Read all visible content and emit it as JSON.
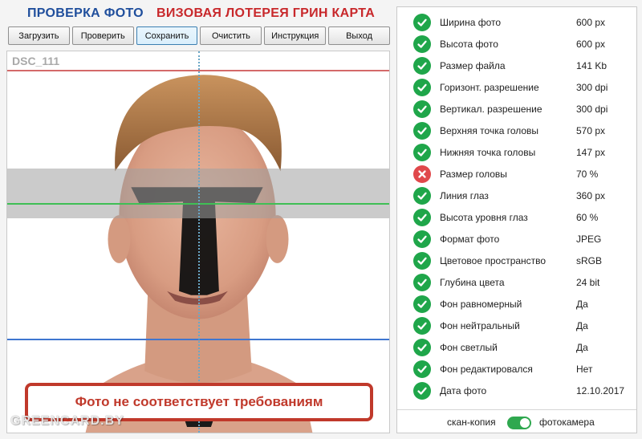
{
  "header": {
    "title_left": "ПРОВЕРКА ФОТО",
    "title_right": "ВИЗОВАЯ ЛОТЕРЕЯ ГРИН КАРТА"
  },
  "toolbar": [
    {
      "label": "Загрузить"
    },
    {
      "label": "Проверить"
    },
    {
      "label": "Сохранить"
    },
    {
      "label": "Очистить"
    },
    {
      "label": "Инструкция"
    },
    {
      "label": "Выход"
    }
  ],
  "photo": {
    "file_name": "DSC_111",
    "status_message": "Фото не соответствует требованиям",
    "watermark": "GREENCARD.BY"
  },
  "checks": [
    {
      "label": "Ширина фото",
      "value": "600 px",
      "status": "ok"
    },
    {
      "label": "Высота фото",
      "value": "600 px",
      "status": "ok"
    },
    {
      "label": "Размер файла",
      "value": "141 Kb",
      "status": "ok"
    },
    {
      "label": "Горизонт. разрешение",
      "value": "300 dpi",
      "status": "ok"
    },
    {
      "label": "Вертикал. разрешение",
      "value": "300 dpi",
      "status": "ok"
    },
    {
      "label": "Верхняя точка головы",
      "value": "570 px",
      "status": "ok"
    },
    {
      "label": "Нижняя точка головы",
      "value": "147 px",
      "status": "ok"
    },
    {
      "label": "Размер головы",
      "value": "70 %",
      "status": "error"
    },
    {
      "label": "Линия глаз",
      "value": "360 px",
      "status": "ok"
    },
    {
      "label": "Высота уровня глаз",
      "value": "60 %",
      "status": "ok"
    },
    {
      "label": "Формат фото",
      "value": "JPEG",
      "status": "ok"
    },
    {
      "label": "Цветовое пространство",
      "value": "sRGB",
      "status": "ok"
    },
    {
      "label": "Глубина цвета",
      "value": "24 bit",
      "status": "ok"
    },
    {
      "label": "Фон равномерный",
      "value": "Да",
      "status": "ok"
    },
    {
      "label": "Фон нейтральный",
      "value": "Да",
      "status": "ok"
    },
    {
      "label": "Фон светлый",
      "value": "Да",
      "status": "ok"
    },
    {
      "label": "Фон редактировался",
      "value": "Нет",
      "status": "ok"
    },
    {
      "label": "Дата фото",
      "value": "12.10.2017",
      "status": "ok"
    }
  ],
  "footer": {
    "scan_label": "скан-копия",
    "camera_label": "фотокамера",
    "toggle_on": true
  },
  "colors": {
    "title_blue": "#1f4e9c",
    "title_red": "#c8282b",
    "ok_green": "#1fa64a",
    "error_red": "#e0484b"
  }
}
